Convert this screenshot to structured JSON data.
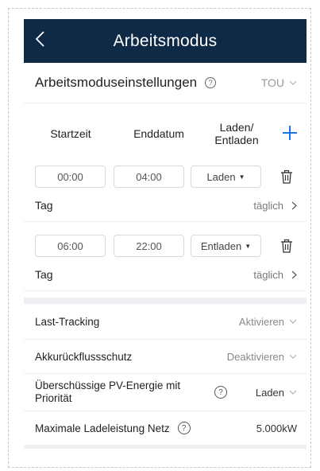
{
  "header": {
    "title": "Arbeitsmodus",
    "back_icon": "chevron-left-icon"
  },
  "settings": {
    "label": "Arbeitsmoduseinstellungen",
    "value": "TOU"
  },
  "columns": {
    "start": "Startzeit",
    "end": "Enddatum",
    "mode_line1": "Laden/",
    "mode_line2": "Entladen"
  },
  "accent_color": "#1a73e8",
  "slots": [
    {
      "start": "00:00",
      "end": "04:00",
      "mode": "Laden",
      "day_label": "Tag",
      "day_value": "täglich"
    },
    {
      "start": "06:00",
      "end": "22:00",
      "mode": "Entladen",
      "day_label": "Tag",
      "day_value": "täglich"
    }
  ],
  "options": {
    "last_tracking": {
      "label": "Last-Tracking",
      "value": "Aktivieren"
    },
    "backflow": {
      "label": "Akkurückflussschutz",
      "value": "Deaktivieren"
    },
    "pv_priority": {
      "label": "Überschüssige PV-Energie mit Priorität",
      "value": "Laden"
    },
    "max_charge": {
      "label": "Maximale Ladeleistung Netz",
      "value": "5.000kW"
    }
  }
}
